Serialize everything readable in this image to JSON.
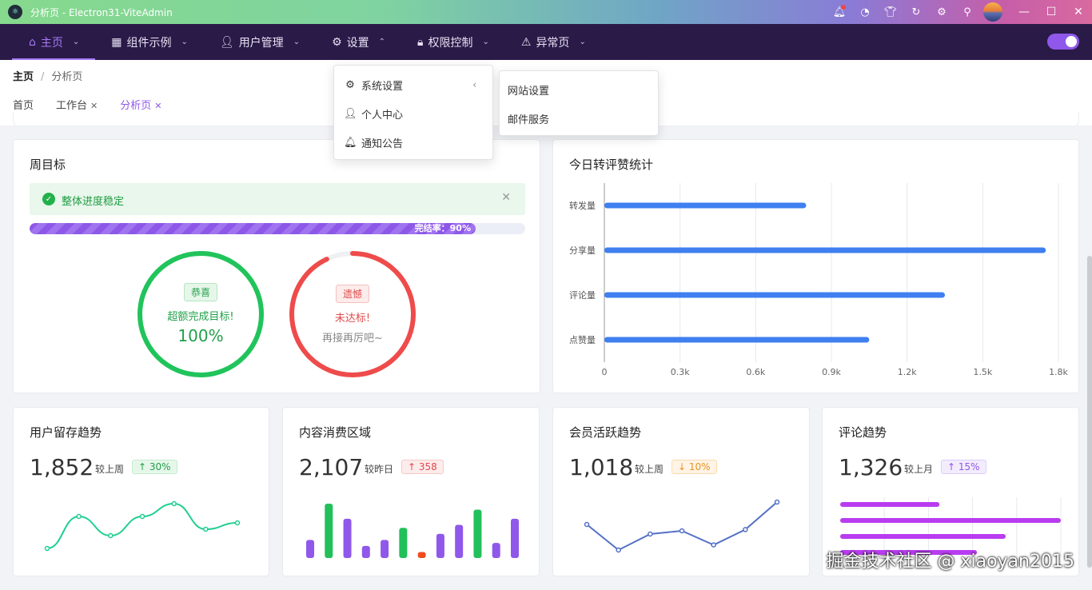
{
  "titlebar": {
    "app_title": "分析页 - Electron31-ViteAdmin",
    "icons": [
      "bell-icon",
      "palette-icon",
      "shirt-icon",
      "refresh-icon",
      "gear-icon",
      "pin-icon"
    ]
  },
  "nav": {
    "items": [
      {
        "label": "主页",
        "icon": "home-icon",
        "active": true
      },
      {
        "label": "组件示例",
        "icon": "grid-icon"
      },
      {
        "label": "用户管理",
        "icon": "user-icon"
      },
      {
        "label": "设置",
        "icon": "gear-icon"
      },
      {
        "label": "权限控制",
        "icon": "lock-icon"
      },
      {
        "label": "异常页",
        "icon": "warning-icon"
      }
    ]
  },
  "breadcrumb": {
    "home": "主页",
    "current": "分析页"
  },
  "tabs": [
    {
      "label": "首页",
      "closable": false
    },
    {
      "label": "工作台",
      "closable": true
    },
    {
      "label": "分析页",
      "closable": true,
      "active": true
    }
  ],
  "settings_menu": {
    "items": [
      {
        "label": "系统设置",
        "icon": "gear-icon"
      },
      {
        "label": "个人中心",
        "icon": "user-lock-icon"
      },
      {
        "label": "通知公告",
        "icon": "bell-icon"
      }
    ],
    "submenu": [
      "网站设置",
      "邮件服务"
    ]
  },
  "week_goal": {
    "title": "周目标",
    "alert": "整体进度稳定",
    "progress_label": "完结率：90%",
    "progress": 0.9,
    "ring1": {
      "tag": "恭喜",
      "msg": "超额完成目标!",
      "value": "100%",
      "level": 1.0
    },
    "ring2": {
      "tag": "遗憾",
      "msg": "未达标!",
      "sub": "再接再厉吧~",
      "level": 0.93
    }
  },
  "today_stats": {
    "title": "今日转评赞统计",
    "chart_data": {
      "type": "bar",
      "orientation": "horizontal",
      "categories": [
        "转发量",
        "分享量",
        "评论量",
        "点赞量"
      ],
      "values": [
        800,
        1750,
        1350,
        1050
      ],
      "xlim": [
        0,
        1800
      ],
      "xticks": [
        "0",
        "0.3k",
        "0.6k",
        "0.9k",
        "1.2k",
        "1.5k",
        "1.8k"
      ],
      "color": "#3f7ff0",
      "grid": true
    }
  },
  "mini_cards": [
    {
      "title": "用户留存趋势",
      "value": "1,852",
      "compare": "较上周",
      "delta": "↑ 30%",
      "delta_style": "up-green",
      "chart_data": {
        "type": "line",
        "smooth": true,
        "values": [
          1,
          6,
          3,
          6,
          8,
          4,
          5
        ],
        "color": "#1ecf8f"
      }
    },
    {
      "title": "内容消费区域",
      "value": "2,107",
      "compare": "较昨日",
      "delta": "↑ 358",
      "delta_style": "up-red",
      "chart_data": {
        "type": "bar",
        "values": [
          3,
          9,
          6.5,
          2,
          3,
          5,
          1,
          4,
          5.5,
          8,
          2.5,
          6.5
        ],
        "colors": [
          "#8f58ea",
          "#22c05a",
          "#8f58ea",
          "#8f58ea",
          "#8f58ea",
          "#22c05a",
          "#f04a1e",
          "#8f58ea",
          "#8f58ea",
          "#22c05a",
          "#8f58ea",
          "#8f58ea"
        ]
      }
    },
    {
      "title": "会员活跃趋势",
      "value": "1,018",
      "compare": "较上周",
      "delta": "↓ 10%",
      "delta_style": "down-orange",
      "chart_data": {
        "type": "line",
        "smooth": false,
        "values": [
          5,
          1,
          3.5,
          4,
          1.8,
          4.2,
          8.5
        ],
        "color": "#5470c6"
      }
    },
    {
      "title": "评论趋势",
      "value": "1,326",
      "compare": "较上月",
      "delta": "↑ 15%",
      "delta_style": "up-purple",
      "chart_data": {
        "type": "bar",
        "orientation": "horizontal",
        "values": [
          4.5,
          10,
          7.5,
          6.2
        ],
        "color": "#b93cf0"
      }
    }
  ],
  "watermark": "掘金技术社区 @ xiaoyan2015"
}
